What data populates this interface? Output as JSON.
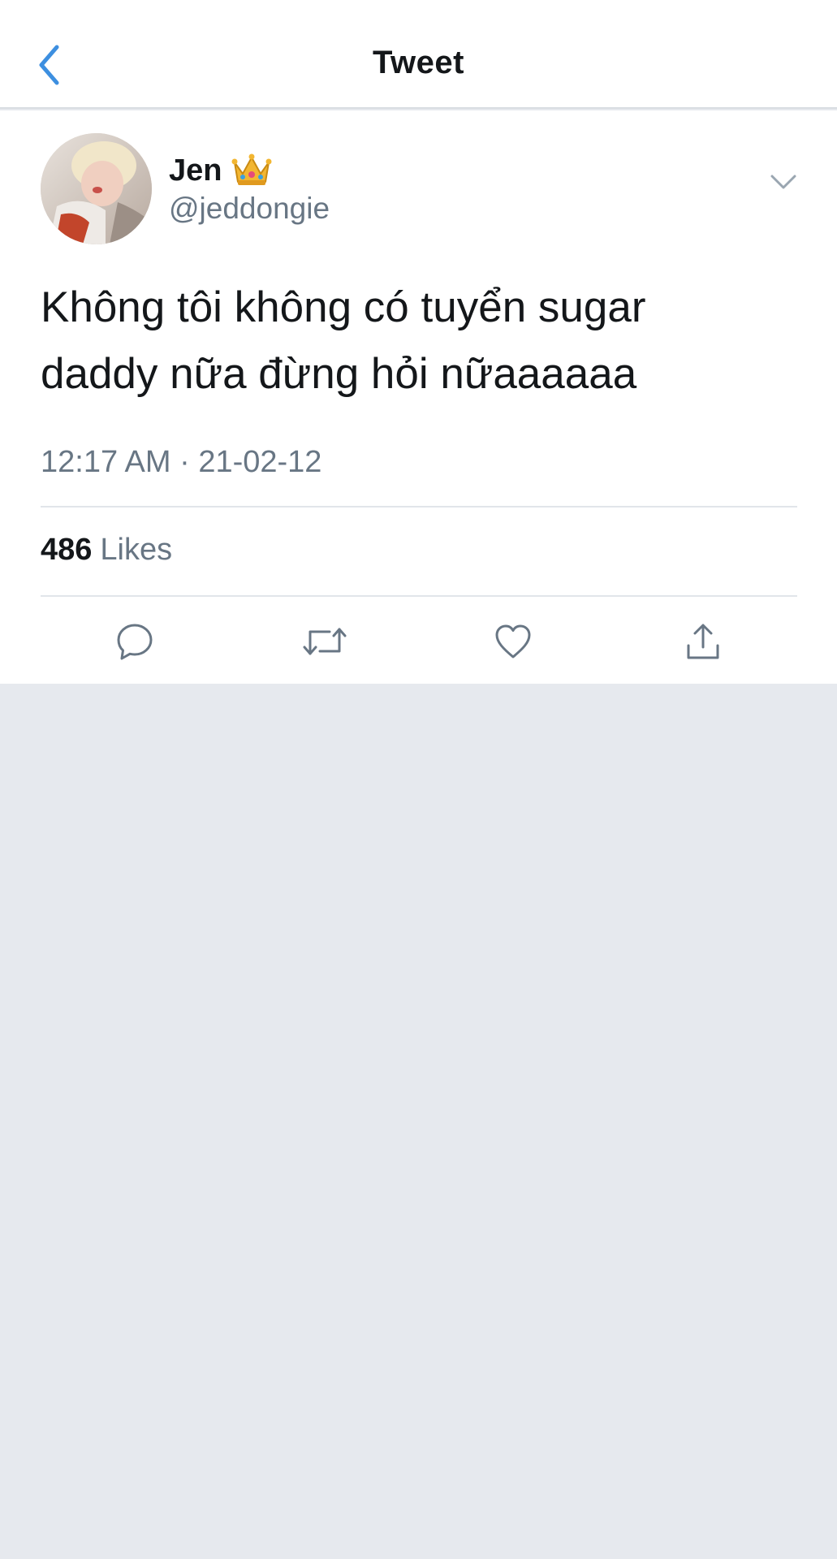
{
  "header": {
    "title": "Tweet",
    "back_icon": "chevron-left-icon",
    "accent_color": "#3d8fe0"
  },
  "tweet": {
    "author": {
      "display_name": "Jen",
      "name_emoji_icon": "crown-icon",
      "handle": "@jeddongie"
    },
    "more_icon": "chevron-down-icon",
    "text": "Không tôi không có tuyển sugar daddy nữa đừng hỏi nữaaaaaa",
    "timestamp": "12:17 AM · 21-02-12",
    "likes": {
      "count": "486",
      "label": "Likes"
    },
    "actions": [
      {
        "name": "reply",
        "icon": "reply-icon"
      },
      {
        "name": "retweet",
        "icon": "retweet-icon"
      },
      {
        "name": "like",
        "icon": "heart-icon"
      },
      {
        "name": "share",
        "icon": "share-icon"
      }
    ]
  },
  "colors": {
    "text_primary": "#14171a",
    "text_secondary": "#687684",
    "background_gray": "#e6e9ee"
  }
}
